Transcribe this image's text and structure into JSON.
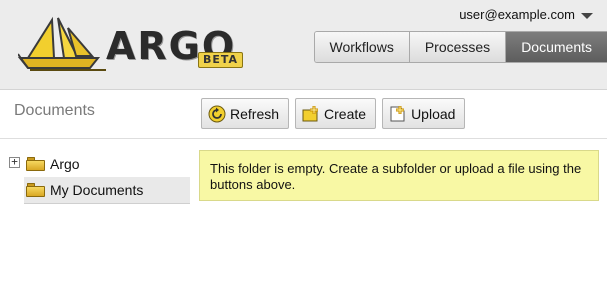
{
  "header": {
    "logo": {
      "word": "ARGO",
      "badge": "BETA"
    },
    "user_menu": {
      "label": "user@example.com",
      "icon": "chevron-down-icon"
    },
    "tabs": [
      {
        "label": "Workflows",
        "active": false
      },
      {
        "label": "Processes",
        "active": false
      },
      {
        "label": "Documents",
        "active": true
      }
    ]
  },
  "page": {
    "title": "Documents"
  },
  "toolbar": {
    "refresh_label": "Refresh",
    "create_label": "Create",
    "upload_label": "Upload"
  },
  "tree": {
    "items": [
      {
        "label": "Argo",
        "expander": "+",
        "selected": false
      },
      {
        "label": "My Documents",
        "selected": true
      }
    ]
  },
  "message": {
    "text": "This folder is empty. Create a subfolder or upload a file using the buttons above."
  },
  "colors": {
    "header_bg": "#ececec",
    "active_tab": "#6a6a6a",
    "message_bg": "#f8f8a4",
    "folder": "#e8c040"
  }
}
